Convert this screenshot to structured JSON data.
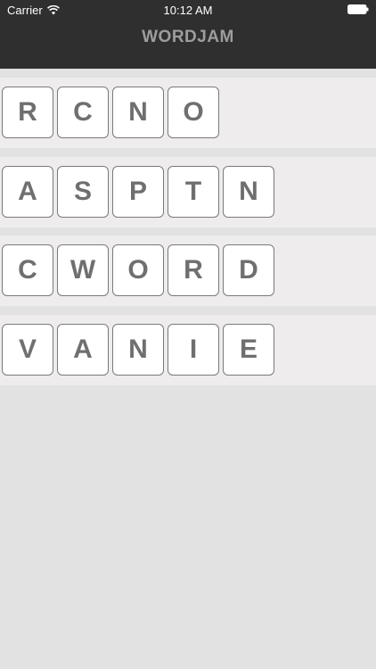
{
  "status_bar": {
    "carrier": "Carrier",
    "time": "10:12 AM",
    "wifi_icon": "wifi-icon",
    "battery_icon": "battery-icon"
  },
  "nav": {
    "title": "WORDJAM"
  },
  "rows": [
    {
      "letters": [
        "R",
        "C",
        "N",
        "O"
      ]
    },
    {
      "letters": [
        "A",
        "S",
        "P",
        "T",
        "N"
      ]
    },
    {
      "letters": [
        "C",
        "W",
        "O",
        "R",
        "D"
      ]
    },
    {
      "letters": [
        "V",
        "A",
        "N",
        "I",
        "E"
      ]
    }
  ],
  "colors": {
    "header_bg": "#2f2f2f",
    "title": "#9d9d9d",
    "row_bg": "#eeecec",
    "page_bg": "#e2e2e2",
    "tile_text": "#6f6f6f"
  }
}
